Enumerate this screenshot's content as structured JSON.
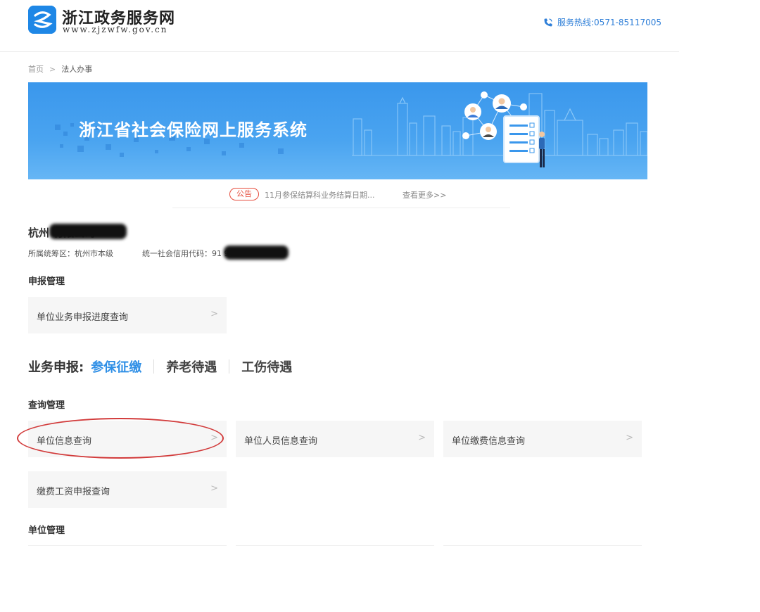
{
  "header": {
    "title": "浙江政务服务网",
    "url": "www.zjzwfw.gov.cn",
    "hotline": "服务热线:0571-85117005",
    "brand_color": "#1e87e6"
  },
  "breadcrumb": {
    "home": "首页",
    "separator": ">",
    "current": "法人办事"
  },
  "banner": {
    "title": "浙江省社会保险网上服务系统"
  },
  "notice": {
    "tag": "公告",
    "text": "11月参保结算科业务结算日期...",
    "more": "查看更多>>"
  },
  "company": {
    "name": "杭州                                有限公司",
    "district": "所属统筹区：杭州市本级",
    "credit_code": "统一社会信用代码：91                        9"
  },
  "declare_mgmt": {
    "title": "申报管理",
    "cards": [
      {
        "label": "单位业务申报进度查询"
      }
    ]
  },
  "business": {
    "label": "业务申报:",
    "tabs": [
      {
        "label": "参保征缴",
        "active": true
      },
      {
        "label": "养老待遇",
        "active": false
      },
      {
        "label": "工伤待遇",
        "active": false
      }
    ],
    "active_color": "#2f8fe6"
  },
  "query_mgmt": {
    "title": "查询管理",
    "cards": [
      {
        "label": "单位信息查询"
      },
      {
        "label": "单位人员信息查询"
      },
      {
        "label": "单位缴费信息查询"
      },
      {
        "label": "缴费工资申报查询"
      }
    ]
  },
  "unit_mgmt": {
    "title": "单位管理"
  },
  "chevron": ">",
  "highlight_color": "#d23b3b"
}
